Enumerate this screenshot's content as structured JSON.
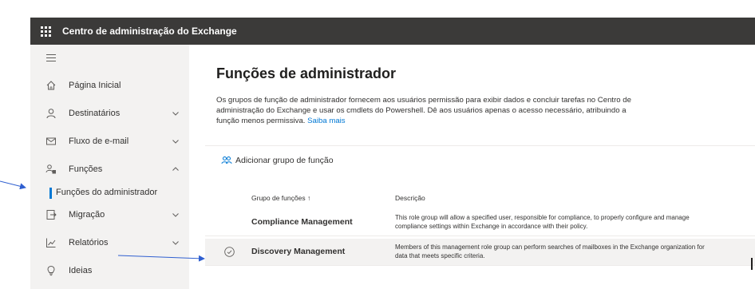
{
  "topbar": {
    "app_title": "Centro de administração do Exchange",
    "waffle_icon": "app-launcher-icon",
    "background": "#3b3a39"
  },
  "sidebar": {
    "menu_icon": "hamburger-icon",
    "items": [
      {
        "label": "Página Inicial",
        "icon": "home-icon",
        "expandable": false
      },
      {
        "label": "Destinatários",
        "icon": "person-icon",
        "expandable": true,
        "state": "collapsed"
      },
      {
        "label": "Fluxo de e-mail",
        "icon": "mail-icon",
        "expandable": true,
        "state": "collapsed"
      },
      {
        "label": "Funções",
        "icon": "roles-icon",
        "expandable": true,
        "state": "expanded"
      },
      {
        "label": "Funções do administrador",
        "sub": true,
        "selected": true
      },
      {
        "label": "Migração",
        "icon": "migration-icon",
        "expandable": true,
        "state": "collapsed"
      },
      {
        "label": "Relatórios",
        "icon": "chart-icon",
        "expandable": true,
        "state": "collapsed"
      },
      {
        "label": "Ideias",
        "icon": "lightbulb-icon",
        "expandable": false
      }
    ],
    "accent": "#0078d4"
  },
  "main": {
    "title": "Funções de administrador",
    "description": "Os grupos de função de administrador fornecem aos usuários permissão para exibir dados e concluir tarefas no Centro de administração do Exchange e usar os cmdlets do Powershell. Dê aos usuários apenas o acesso necessário, atribuindo a função menos permissiva.",
    "learn_more": "Saiba mais",
    "add_button": "Adicionar grupo de função",
    "table": {
      "col_group": "Grupo de funções",
      "sort_indicator": "↑",
      "col_desc": "Descrição",
      "rows": [
        {
          "name": "Compliance Management",
          "description": "This role group will allow a specified user, responsible for compliance, to properly configure and manage compliance settings within Exchange in accordance with their policy.",
          "selected": false
        },
        {
          "name": "Discovery Management",
          "description": "Members of this management role group can perform searches of mailboxes in the Exchange organization for data that meets specific criteria.",
          "selected": true
        }
      ]
    }
  },
  "annotations": {
    "arrow_color": "#2f5fd0"
  }
}
